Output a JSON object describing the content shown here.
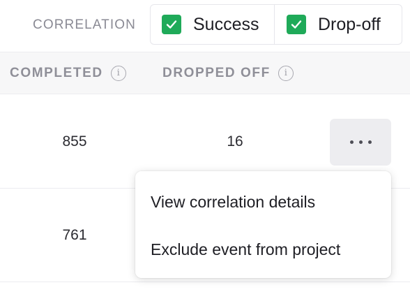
{
  "filter": {
    "label": "CORRELATION",
    "toggles": [
      {
        "label": "Success",
        "checked": true
      },
      {
        "label": "Drop-off",
        "checked": true
      }
    ]
  },
  "table": {
    "columns": [
      {
        "label": "COMPLETED",
        "icon": "info-icon"
      },
      {
        "label": "DROPPED OFF",
        "icon": "info-icon"
      }
    ],
    "rows": [
      {
        "completed": "855",
        "dropped_off": "16"
      },
      {
        "completed": "761",
        "dropped_off": ""
      }
    ]
  },
  "row_actions": {
    "icon": "more-horizontal-icon"
  },
  "menu": {
    "items": [
      {
        "label": "View correlation details"
      },
      {
        "label": "Exclude event from project"
      }
    ]
  },
  "colors": {
    "check_green": "#1faa59",
    "header_bg": "#f7f7f8",
    "more_button_bg": "#ededf0",
    "muted_text": "#8f8f98"
  }
}
